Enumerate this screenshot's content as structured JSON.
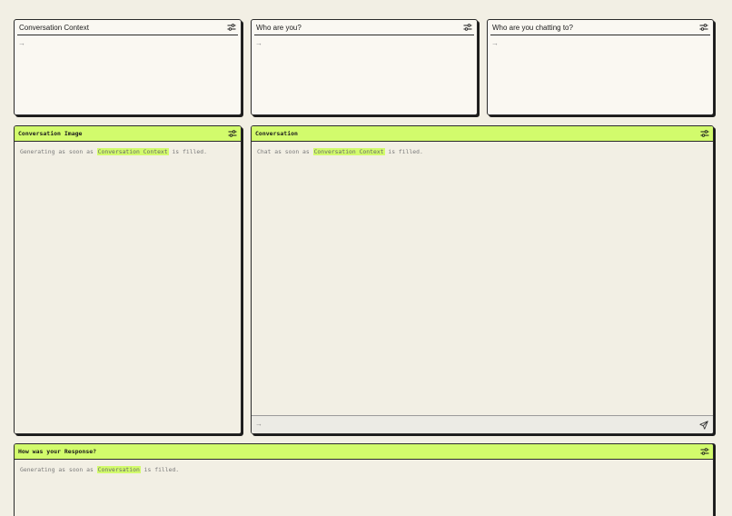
{
  "panels": {
    "context": {
      "title": "Conversation Context",
      "placeholder": "→"
    },
    "who_you": {
      "title": "Who are you?",
      "placeholder": "→"
    },
    "who_chatting": {
      "title": "Who are you chatting to?",
      "placeholder": "→"
    },
    "image": {
      "title": "Conversation Image",
      "status_pre": "Generating as soon as ",
      "status_highlight": "Conversation Context",
      "status_post": " is filled."
    },
    "conversation": {
      "title": "Conversation",
      "status_pre": "Chat as soon as ",
      "status_highlight": "Conversation Context",
      "status_post": " is filled.",
      "input_placeholder": "→"
    },
    "response": {
      "title": "How was your Response?",
      "status_pre": "Generating as soon as ",
      "status_highlight": "Conversation",
      "status_post": " is filled."
    }
  },
  "icons": {
    "settings": "sliders-icon",
    "send": "send-icon"
  },
  "colors": {
    "background": "#f2efe4",
    "panel": "#faf8f2",
    "accent": "#d2fb6c",
    "border": "#2a2a2a"
  }
}
